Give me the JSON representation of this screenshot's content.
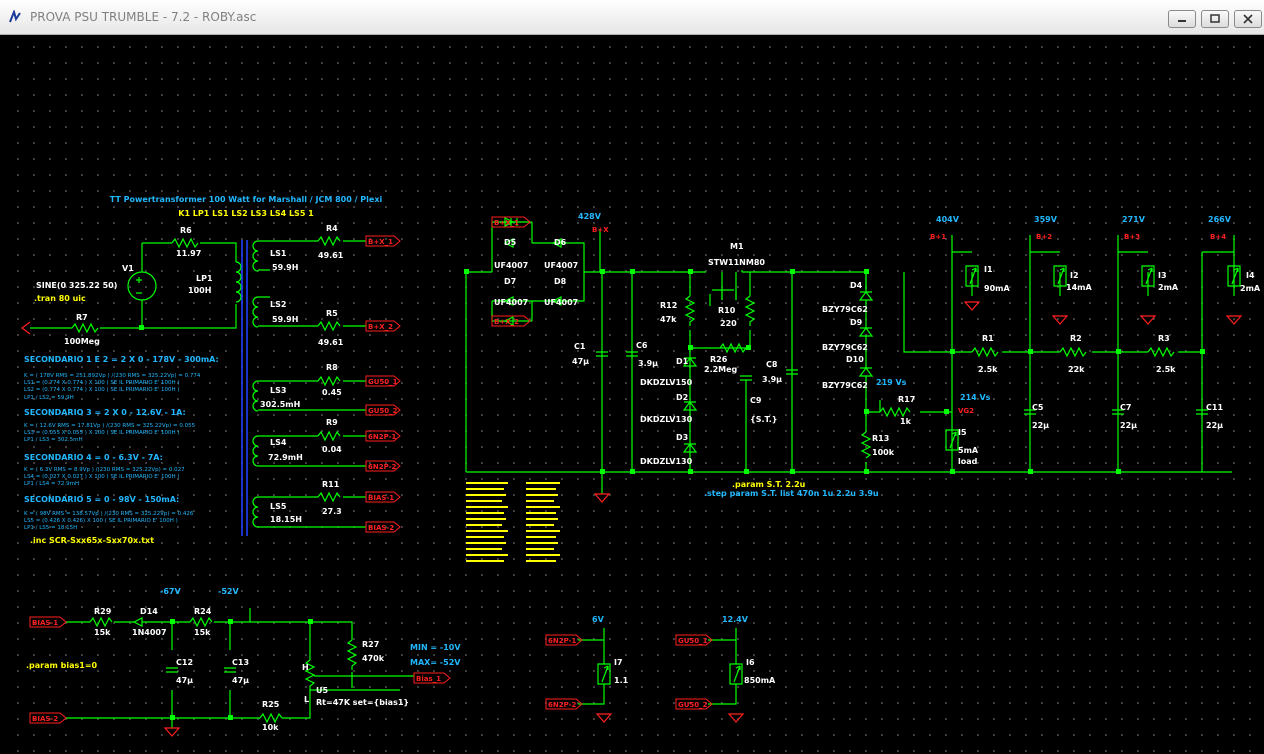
{
  "window": {
    "title": "PROVA PSU TRUMBLE - 7.2 - ROBY.asc",
    "buttons": [
      "minimize",
      "restore",
      "close"
    ]
  },
  "colors": {
    "wire": "#00ff00",
    "label": "#ffffff",
    "net": "#ff2020",
    "voltage": "#22b8ff",
    "directive": "#ffff00",
    "component": "#00ff00"
  },
  "header": {
    "line1": "TT Powertransformer 100 Watt for Marshall / JCM 800 / Plexi",
    "line2": "K1 LP1 LS1 LS2 LS3 LS4 LS5 1"
  },
  "source": {
    "name": "V1",
    "value1": "SINE(0 325.22 50)",
    "value2": ".tran 80 uic"
  },
  "components": {
    "R6": {
      "name": "R6",
      "value": "11.97"
    },
    "R7": {
      "name": "R7",
      "value": "100Meg"
    },
    "LP1": {
      "name": "LP1",
      "value": "100H"
    },
    "LS1": {
      "name": "LS1",
      "value": "59.9H"
    },
    "LS2": {
      "name": "LS2",
      "value": "59.9H"
    },
    "LS3": {
      "name": "LS3",
      "value": "302.5mH"
    },
    "LS4": {
      "name": "LS4",
      "value": "72.9mH"
    },
    "LS5": {
      "name": "LS5",
      "value": "18.15H"
    },
    "R4": {
      "name": "R4",
      "value": "49.61"
    },
    "R5": {
      "name": "R5",
      "value": "49.61"
    },
    "R8": {
      "name": "R8",
      "value": "0.45"
    },
    "R9": {
      "name": "R9",
      "value": "0.04"
    },
    "R11": {
      "name": "R11",
      "value": "27.3"
    },
    "D5": {
      "name": "D5",
      "value": "UF4007"
    },
    "D6": {
      "name": "D6",
      "value": "UF4007"
    },
    "D7": {
      "name": "D7",
      "value": "UF4007"
    },
    "D8": {
      "name": "D8",
      "value": "UF4007"
    },
    "C1": {
      "name": "C1",
      "value": "47µ"
    },
    "C6": {
      "name": "C6",
      "value": "3.9µ"
    },
    "R12": {
      "name": "R12",
      "value": "47k"
    },
    "M1": {
      "name": "M1",
      "value": "STW11NM80"
    },
    "R10": {
      "name": "R10",
      "value": "220"
    },
    "R26": {
      "name": "R26",
      "value": "2.2Meg"
    },
    "C8": {
      "name": "C8",
      "value": "3.9µ"
    },
    "C9": {
      "name": "C9",
      "value": "{S.T.}"
    },
    "D1": {
      "name": "D1",
      "value": "DKDZLV150"
    },
    "D2": {
      "name": "D2",
      "value": "DKDZLV130"
    },
    "D3": {
      "name": "D3",
      "value": "DKDZLV130"
    },
    "D4": {
      "name": "D4",
      "value": "BZY79C62"
    },
    "D9": {
      "name": "D9",
      "value": "BZY79C62"
    },
    "D10": {
      "name": "D10",
      "value": "BZY79C62"
    },
    "R13": {
      "name": "R13",
      "value": "100k"
    },
    "R17": {
      "name": "R17",
      "value": "1k"
    },
    "I5": {
      "name": "I5",
      "value1": "5mA",
      "value2": "load"
    },
    "I1": {
      "name": "I1",
      "value": "90mA"
    },
    "I2": {
      "name": "I2",
      "value": "14mA"
    },
    "I3": {
      "name": "I3",
      "value": "2mA"
    },
    "I4": {
      "name": "I4",
      "value": "2mA"
    },
    "R1": {
      "name": "R1",
      "value": "2.5k"
    },
    "R2": {
      "name": "R2",
      "value": "22k"
    },
    "R3": {
      "name": "R3",
      "value": "2.5k"
    },
    "C5": {
      "name": "C5",
      "value": "22µ"
    },
    "C7": {
      "name": "C7",
      "value": "22µ"
    },
    "C11": {
      "name": "C11",
      "value": "22µ"
    },
    "R29": {
      "name": "R29",
      "value": "15k"
    },
    "D14": {
      "name": "D14",
      "value": "1N4007"
    },
    "R24": {
      "name": "R24",
      "value": "15k"
    },
    "C12": {
      "name": "C12",
      "value": "47µ"
    },
    "C13": {
      "name": "C13",
      "value": "47µ"
    },
    "R25": {
      "name": "R25",
      "value": "10k"
    },
    "R27": {
      "name": "R27",
      "value": "470k"
    },
    "U5": {
      "name": "U5",
      "value": "Rt=47K set={bias1}",
      "pinH": "H",
      "pinL": "L"
    },
    "I7": {
      "name": "I7",
      "value": "1.1"
    },
    "I6": {
      "name": "I6",
      "value": "850mA"
    }
  },
  "nets": {
    "bxx1": "B+X_1",
    "bxx2": "B+X_2",
    "bx": "B+X",
    "gu50_1": "GU50_1",
    "gu50_2": "GU50_2",
    "n6n2p1": "6N2P-1",
    "n6n2p2": "6N2P-2",
    "bias1": "BIAS-1",
    "bias2": "BIAS-2",
    "bp1": "B+1",
    "bp2": "B+2",
    "bp3": "B+3",
    "bp4": "B+4",
    "vg2": "VG2",
    "bias_1": "Bias_1"
  },
  "voltages": {
    "v428": "428V",
    "v404": "404V",
    "v359": "359V",
    "v271": "271V",
    "v266": "266V",
    "v219": "219 Vs",
    "v214": "214 Vs",
    "v67": "-67V",
    "v52": "-52V",
    "v6": "6V",
    "v124": "12.4V",
    "min": "MIN = -10V",
    "max": "MAX= -52V"
  },
  "notes": {
    "sec12": {
      "title": "SECONDARIO 1 E 2 = 2 X 0 - 178V - 300mA:",
      "lines": [
        "K = ( 178V RMS = 251.892Vp ) /(230 RMS = 325.22Vp) = 0.774",
        "LS1 = (0.774  X 0.774 ) X 100 ( SE IL PRIMARIO E' 100H )",
        "LS2 = (0.774  X 0.774 ) X 100 ( SE IL PRIMARIO E' 100H )",
        "LP1 / LS2 = 59.9H"
      ]
    },
    "sec3": {
      "title": "SECONDARIO 3 = 2 X 0 - 12.6V - 1A:",
      "lines": [
        "K = ( 12.6V RMS = 17.81Vp ) /(230 RMS = 325.22Vp) = 0.055",
        "LS3 = (0.055  X 0.055 ) X 100 ( SE IL PRIMARIO E' 100H )",
        "LP1 / LS3 = 302.5mH"
      ]
    },
    "sec4": {
      "title": "SECONDARIO 4 = 0 - 6.3V - 7A:",
      "lines": [
        "K = ( 6.3V RMS = 8.9Vp ) /(230 RMS = 325.22Vp) = 0.027",
        "LS4 = (0.027  X 0.027 ) X 100 ( SE IL PRIMARIO E' 100H )",
        "LP1 / LS4 = 72.9mH"
      ]
    },
    "sec5": {
      "title": "SECONDARIO 5 = 0 - 98V - 150mA:",
      "lines": [
        "K = ( 98V RMS = 138.57Vp ) /(230 RMS = 325.22Vp) = 0.426",
        "LS5 = (0.426  X 0.426) X 100 ( SE IL PRIMARIO E' 100H )",
        "LP1 / LS5 = 18.15H"
      ]
    },
    "inc": ".inc SCR-Sxx65x-Sxx70x.txt",
    "param_bias": ".param bias1=0",
    "param_st": ".param S.T. 2.2u",
    "step": ".step param S.T. list 470n 1u 2.2u 3.9u"
  }
}
